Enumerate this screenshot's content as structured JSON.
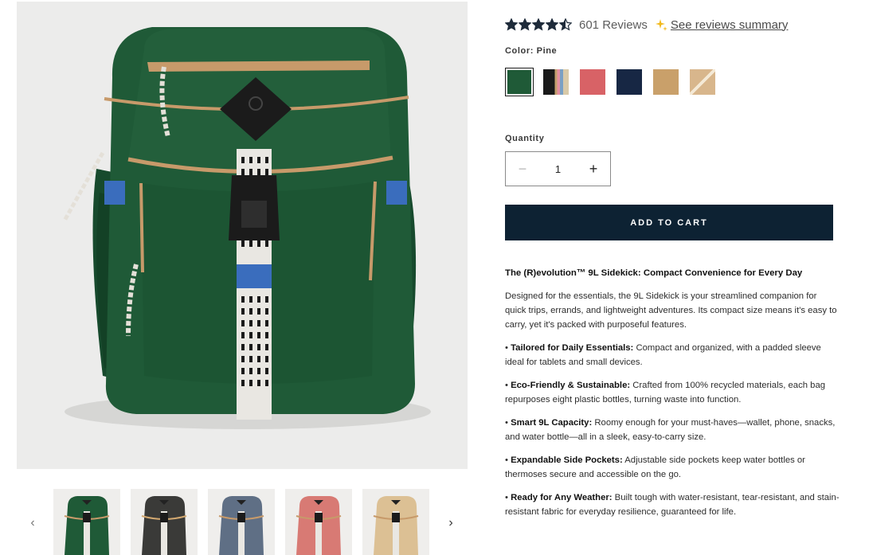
{
  "product": {
    "main_image_icon": "green-backpack-image",
    "thumbnails": [
      {
        "name": "pine",
        "body": "#1f5a37",
        "trim": "#c79a6a"
      },
      {
        "name": "black-multi",
        "body": "#3a3a38",
        "trim": "#d2a870"
      },
      {
        "name": "navy",
        "body": "#5f6f85",
        "trim": "#c79a6a"
      },
      {
        "name": "rose",
        "body": "#d87a74",
        "trim": "#c79a6a"
      },
      {
        "name": "sand",
        "body": "#dcc094",
        "trim": "#c79a6a"
      }
    ]
  },
  "rating": {
    "stars": 4.5,
    "review_count": "601 Reviews",
    "summary_link": "See reviews summary"
  },
  "color": {
    "label": "Color: Pine",
    "swatches": [
      {
        "name": "pine",
        "color": "#1f5a37",
        "selected": true
      },
      {
        "name": "multi",
        "color": "#2a2a2a",
        "selected": false
      },
      {
        "name": "rose",
        "color": "#d86266",
        "selected": false
      },
      {
        "name": "navy",
        "color": "#172744",
        "selected": false
      },
      {
        "name": "tan",
        "color": "#c9a06a",
        "selected": false
      },
      {
        "name": "sand",
        "color": "#d8b68c",
        "selected": false
      }
    ]
  },
  "quantity": {
    "label": "Quantity",
    "value": "1",
    "minus": "−",
    "plus": "+"
  },
  "cart": {
    "add_label": "ADD TO CART",
    "color": "#0d2233"
  },
  "description": {
    "heading": "The (R)evolution™ 9L Sidekick: Compact Convenience for Every Day",
    "intro": "Designed for the essentials, the 9L Sidekick is your streamlined companion for quick trips, errands, and lightweight adventures. Its compact size means it's easy to carry, yet it's packed with purposeful features.",
    "bullets": [
      {
        "title": "Tailored for Daily Essentials:",
        "text": " Compact and organized, with a padded sleeve ideal for tablets and small devices."
      },
      {
        "title": "Eco-Friendly & Sustainable:",
        "text": " Crafted from 100% recycled materials, each bag repurposes eight plastic bottles, turning waste into function."
      },
      {
        "title": "Smart 9L Capacity:",
        "text": " Roomy enough for your must-haves—wallet, phone, snacks, and water bottle—all in a sleek, easy-to-carry size."
      },
      {
        "title": "Expandable Side Pockets:",
        "text": " Adjustable side pockets keep water bottles or thermoses secure and accessible on the go."
      },
      {
        "title": "Ready for Any Weather:",
        "text": " Built tough with water-resistant, tear-resistant, and stain-resistant fabric for everyday resilience, guaranteed for life."
      }
    ]
  },
  "nav": {
    "prev_icon": "chevron-left-icon",
    "next_icon": "chevron-right-icon",
    "prev_glyph": "‹",
    "next_glyph": "›"
  }
}
